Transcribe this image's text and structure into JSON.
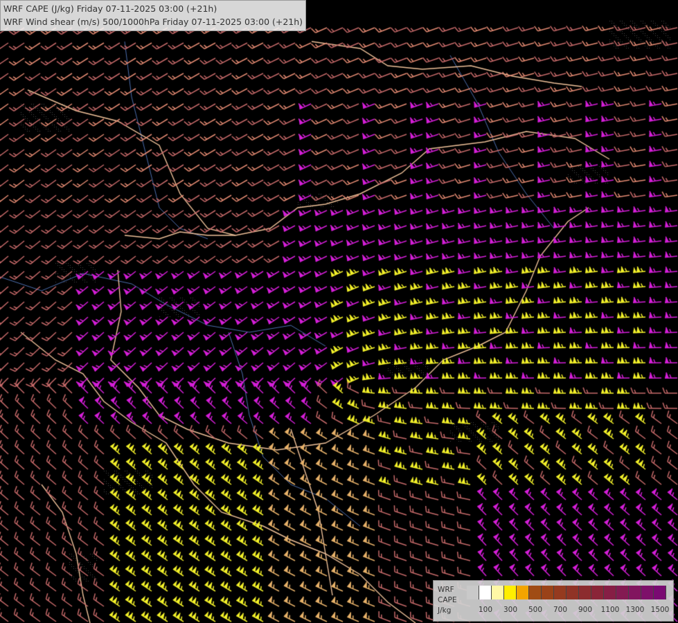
{
  "header": {
    "line1": "WRF CAPE (J/kg) Friday 07-11-2025 03:00 (+21h)",
    "line2": "WRF Wind shear (m/s) 500/1000hPa Friday 07-11-2025 03:00 (+21h)"
  },
  "legend": {
    "label_lines": [
      "WRF",
      "CAPE",
      "J/kg"
    ],
    "swatches": [
      "#c9c9c9",
      "#ffffff",
      "#fff7a6",
      "#ffee00",
      "#f3a400",
      "#a04c14",
      "#9a4218",
      "#953a1f",
      "#903326",
      "#8c2c2e",
      "#8a2438",
      "#861e45",
      "#841a52",
      "#82155f",
      "#7e106a",
      "#7a0a72"
    ],
    "ticks": [
      {
        "label": "100",
        "at": 1
      },
      {
        "label": "300",
        "at": 3
      },
      {
        "label": "500",
        "at": 5
      },
      {
        "label": "700",
        "at": 7
      },
      {
        "label": "900",
        "at": 9
      },
      {
        "label": "1100",
        "at": 11
      },
      {
        "label": "1300",
        "at": 13
      },
      {
        "label": "1500",
        "at": 15
      }
    ]
  },
  "map": {
    "background": "#000000",
    "barb_colors": {
      "weak": "#c76a6a",
      "moderate": "#e58b73",
      "strong": "#d51fd8",
      "very_strong": "#f2f02a",
      "extreme": "#e8b26a"
    },
    "border_color": "#f0c29a",
    "river_color": "#4d6fb0"
  }
}
